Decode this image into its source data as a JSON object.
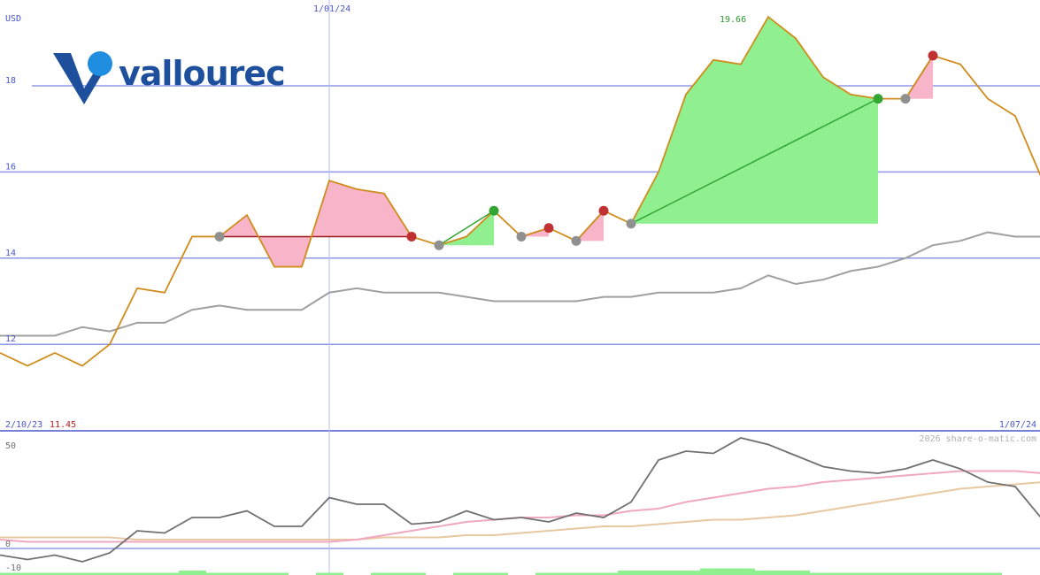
{
  "chart_data": [
    {
      "type": "line",
      "currency_label": "USD",
      "company_logo_text": "vallourec",
      "date_marker": "1/01/24",
      "start_label": "2/10/23",
      "start_value": "11.45",
      "end_label": "1/07/24",
      "peak_label": "19.66",
      "y_tick_labels": [
        "12",
        "14",
        "16",
        "18"
      ],
      "ylim": [
        11.0,
        20.0
      ],
      "grid": true,
      "colors": {
        "price": "#d08c1c",
        "moving_average": "#a0a0a0",
        "grid": "#8f98e8",
        "gain": "#90f090",
        "loss": "#f8b4c8",
        "gain_marker": "#33a532",
        "loss_marker": "#c03232",
        "neutral_marker": "#909090"
      },
      "series": [
        {
          "values": [
            11.8,
            11.5,
            11.8,
            11.5,
            12.0,
            13.3,
            13.2,
            14.5,
            14.5,
            15.0,
            13.8,
            13.8,
            15.8,
            15.6,
            15.5,
            14.5,
            14.3,
            14.5,
            15.1,
            14.5,
            14.7,
            14.4,
            15.1,
            14.8,
            16.0,
            17.8,
            18.6,
            18.5,
            19.6,
            19.1,
            18.2,
            17.8,
            17.7,
            17.7,
            18.7,
            18.5,
            17.7,
            17.3,
            15.8,
            15.8
          ]
        },
        {
          "values": [
            12.2,
            12.2,
            12.2,
            12.4,
            12.3,
            12.5,
            12.5,
            12.8,
            12.9,
            12.8,
            12.8,
            12.8,
            13.2,
            13.3,
            13.2,
            13.2,
            13.2,
            13.1,
            13.0,
            13.0,
            13.0,
            13.0,
            13.1,
            13.1,
            13.2,
            13.2,
            13.2,
            13.3,
            13.6,
            13.4,
            13.5,
            13.7,
            13.8,
            14.0,
            14.3,
            14.4,
            14.6,
            14.5,
            14.5,
            14.7
          ]
        }
      ],
      "trades": [
        {
          "from": 8,
          "to": 15,
          "result": "loss"
        },
        {
          "from": 16,
          "to": 18,
          "result": "gain"
        },
        {
          "from": 19,
          "to": 20,
          "result": "loss"
        },
        {
          "from": 21,
          "to": 22,
          "result": "loss"
        },
        {
          "from": 23,
          "to": 32,
          "result": "gain"
        },
        {
          "from": 33,
          "to": 34,
          "result": "loss"
        }
      ]
    },
    {
      "type": "line",
      "y_tick_labels": [
        "50",
        "0",
        "-10"
      ],
      "ylim": [
        -10,
        50
      ],
      "watermark": "2026 share-o-matic.com",
      "colors": {
        "momentum": "#707070",
        "pink_average": "#f0a8c0",
        "tan_average": "#e8c8a0",
        "bars": "#90f090"
      },
      "series": [
        {
          "values": [
            -3,
            -5,
            -3,
            -6,
            -2,
            8,
            7,
            14,
            14,
            17,
            10,
            10,
            23,
            20,
            20,
            11,
            12,
            17,
            13,
            14,
            12,
            16,
            14,
            21,
            40,
            44,
            43,
            50,
            47,
            42,
            37,
            35,
            34,
            36,
            40,
            36,
            30,
            28,
            13,
            12
          ]
        },
        {
          "values": [
            4,
            3,
            3,
            3,
            3,
            3,
            3,
            3,
            3,
            3,
            3,
            3,
            3,
            4,
            6,
            8,
            10,
            12,
            13,
            14,
            14,
            15,
            15,
            17,
            18,
            21,
            23,
            25,
            27,
            28,
            30,
            31,
            32,
            33,
            34,
            35,
            35,
            35,
            34,
            33
          ]
        },
        {
          "values": [
            5,
            5,
            5,
            5,
            5,
            4,
            4,
            4,
            4,
            4,
            4,
            4,
            4,
            4,
            5,
            5,
            5,
            6,
            6,
            7,
            8,
            9,
            10,
            10,
            11,
            12,
            13,
            13,
            14,
            15,
            17,
            19,
            21,
            23,
            25,
            27,
            28,
            29,
            30,
            32
          ]
        }
      ],
      "bars": [
        1,
        1,
        1,
        1,
        1,
        1,
        1,
        2,
        1,
        1,
        1,
        0,
        1,
        0,
        1,
        1,
        0,
        1,
        1,
        0,
        1,
        1,
        1,
        2,
        2,
        2,
        3,
        3,
        2,
        2,
        1,
        1,
        1,
        1,
        1,
        1,
        1,
        0,
        0,
        0
      ]
    }
  ]
}
